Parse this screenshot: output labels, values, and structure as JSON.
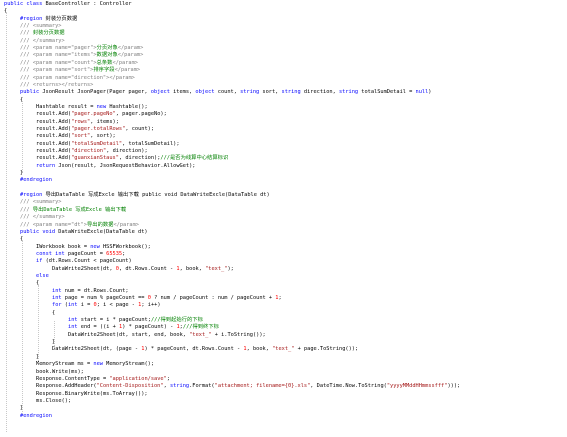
{
  "editor": {
    "lines": [
      {
        "indent": 0,
        "tokens": [
          {
            "k": "kw",
            "t": "public class "
          },
          {
            "k": "tx",
            "t": "BaseController : Controller"
          }
        ]
      },
      {
        "indent": 0,
        "tokens": [
          {
            "k": "tx",
            "t": "{"
          }
        ]
      },
      {
        "indent": 1,
        "tokens": [
          {
            "k": "rg",
            "t": "#region "
          },
          {
            "k": "tx",
            "t": "封装分页数据"
          }
        ]
      },
      {
        "indent": 1,
        "tokens": [
          {
            "k": "dc",
            "t": "/// "
          },
          {
            "k": "dc",
            "t": "<summary>"
          }
        ]
      },
      {
        "indent": 1,
        "tokens": [
          {
            "k": "dc",
            "t": "/// "
          },
          {
            "k": "cm",
            "t": "封装分页数据"
          }
        ]
      },
      {
        "indent": 1,
        "tokens": [
          {
            "k": "dc",
            "t": "/// "
          },
          {
            "k": "dc",
            "t": "</summary>"
          }
        ]
      },
      {
        "indent": 1,
        "tokens": [
          {
            "k": "dc",
            "t": "/// "
          },
          {
            "k": "dc",
            "t": "<param name=\"pager\">"
          },
          {
            "k": "cm",
            "t": "分页对象"
          },
          {
            "k": "dc",
            "t": "</param>"
          }
        ]
      },
      {
        "indent": 1,
        "tokens": [
          {
            "k": "dc",
            "t": "/// "
          },
          {
            "k": "dc",
            "t": "<param name=\"items\">"
          },
          {
            "k": "cm",
            "t": "数据对象"
          },
          {
            "k": "dc",
            "t": "</param>"
          }
        ]
      },
      {
        "indent": 1,
        "tokens": [
          {
            "k": "dc",
            "t": "/// "
          },
          {
            "k": "dc",
            "t": "<param name=\"count\">"
          },
          {
            "k": "cm",
            "t": "总条数"
          },
          {
            "k": "dc",
            "t": "</param>"
          }
        ]
      },
      {
        "indent": 1,
        "tokens": [
          {
            "k": "dc",
            "t": "/// "
          },
          {
            "k": "dc",
            "t": "<param name=\"sort\">"
          },
          {
            "k": "cm",
            "t": "排序字段"
          },
          {
            "k": "dc",
            "t": "</param>"
          }
        ]
      },
      {
        "indent": 1,
        "tokens": [
          {
            "k": "dc",
            "t": "/// "
          },
          {
            "k": "dc",
            "t": "<param name=\"direction\">"
          },
          {
            "k": "dc",
            "t": "</param>"
          }
        ]
      },
      {
        "indent": 1,
        "tokens": [
          {
            "k": "dc",
            "t": "/// "
          },
          {
            "k": "dc",
            "t": "<returns></returns>"
          }
        ]
      },
      {
        "indent": 1,
        "tokens": [
          {
            "k": "kw",
            "t": "public "
          },
          {
            "k": "tx",
            "t": "JsonResult JsonPager(Pager pager, "
          },
          {
            "k": "kw",
            "t": "object "
          },
          {
            "k": "tx",
            "t": "items, "
          },
          {
            "k": "kw",
            "t": "object "
          },
          {
            "k": "tx",
            "t": "count, "
          },
          {
            "k": "kw",
            "t": "string "
          },
          {
            "k": "tx",
            "t": "sort, "
          },
          {
            "k": "kw",
            "t": "string "
          },
          {
            "k": "tx",
            "t": "direction, "
          },
          {
            "k": "kw",
            "t": "string "
          },
          {
            "k": "tx",
            "t": "totalSumDetail = "
          },
          {
            "k": "kw",
            "t": "null"
          },
          {
            "k": "tx",
            "t": ")"
          }
        ]
      },
      {
        "indent": 1,
        "tokens": [
          {
            "k": "tx",
            "t": "{"
          }
        ]
      },
      {
        "indent": 2,
        "tokens": [
          {
            "k": "tx",
            "t": "Hashtable result = "
          },
          {
            "k": "kw",
            "t": "new "
          },
          {
            "k": "tx",
            "t": "Hashtable();"
          }
        ]
      },
      {
        "indent": 2,
        "tokens": [
          {
            "k": "tx",
            "t": "result.Add("
          },
          {
            "k": "st",
            "t": "\"pager.pageNo\""
          },
          {
            "k": "tx",
            "t": ", pager.pageNo);"
          }
        ]
      },
      {
        "indent": 2,
        "tokens": [
          {
            "k": "tx",
            "t": "result.Add("
          },
          {
            "k": "st",
            "t": "\"rows\""
          },
          {
            "k": "tx",
            "t": ", items);"
          }
        ]
      },
      {
        "indent": 2,
        "tokens": [
          {
            "k": "tx",
            "t": "result.Add("
          },
          {
            "k": "st",
            "t": "\"pager.totalRows\""
          },
          {
            "k": "tx",
            "t": ", count);"
          }
        ]
      },
      {
        "indent": 2,
        "tokens": [
          {
            "k": "tx",
            "t": "result.Add("
          },
          {
            "k": "st",
            "t": "\"sort\""
          },
          {
            "k": "tx",
            "t": ", sort);"
          }
        ]
      },
      {
        "indent": 2,
        "tokens": [
          {
            "k": "tx",
            "t": "result.Add("
          },
          {
            "k": "st",
            "t": "\"totalSumDetail\""
          },
          {
            "k": "tx",
            "t": ", totalSumDetail);"
          }
        ]
      },
      {
        "indent": 2,
        "tokens": [
          {
            "k": "tx",
            "t": "result.Add("
          },
          {
            "k": "st",
            "t": "\"direction\""
          },
          {
            "k": "tx",
            "t": ", direction);"
          }
        ]
      },
      {
        "indent": 2,
        "tokens": [
          {
            "k": "tx",
            "t": "result.Add("
          },
          {
            "k": "st",
            "t": "\"guanxianStaus\""
          },
          {
            "k": "tx",
            "t": ", direction);"
          },
          {
            "k": "cm",
            "t": "///是否为线算中心结算标识"
          }
        ]
      },
      {
        "indent": 2,
        "tokens": [
          {
            "k": "kw",
            "t": "return "
          },
          {
            "k": "tx",
            "t": "Json(result, JsonRequestBehavior.AllowGet);"
          }
        ]
      },
      {
        "indent": 1,
        "tokens": [
          {
            "k": "tx",
            "t": "}"
          }
        ]
      },
      {
        "indent": 1,
        "tokens": [
          {
            "k": "rg",
            "t": "#endregion"
          }
        ]
      },
      {
        "indent": 0,
        "tokens": [
          {
            "k": "tx",
            "t": ""
          }
        ]
      },
      {
        "indent": 1,
        "tokens": [
          {
            "k": "rg",
            "t": "#region "
          },
          {
            "k": "tx",
            "t": "导出DataTable 写成Excle 输出下载 public void DataWriteExcle(DataTable dt)"
          }
        ]
      },
      {
        "indent": 1,
        "tokens": [
          {
            "k": "dc",
            "t": "/// "
          },
          {
            "k": "dc",
            "t": "<summary>"
          }
        ]
      },
      {
        "indent": 1,
        "tokens": [
          {
            "k": "dc",
            "t": "/// "
          },
          {
            "k": "cm",
            "t": "导出DataTable 写成Excle 输出下载"
          }
        ]
      },
      {
        "indent": 1,
        "tokens": [
          {
            "k": "dc",
            "t": "/// "
          },
          {
            "k": "dc",
            "t": "</summary>"
          }
        ]
      },
      {
        "indent": 1,
        "tokens": [
          {
            "k": "dc",
            "t": "/// "
          },
          {
            "k": "dc",
            "t": "<param name=\"dt\">"
          },
          {
            "k": "cm",
            "t": "导出的数据"
          },
          {
            "k": "dc",
            "t": "</param>"
          }
        ]
      },
      {
        "indent": 1,
        "tokens": [
          {
            "k": "kw",
            "t": "public void "
          },
          {
            "k": "tx",
            "t": "DataWriteExcle(DataTable dt)"
          }
        ]
      },
      {
        "indent": 1,
        "tokens": [
          {
            "k": "tx",
            "t": "{"
          }
        ]
      },
      {
        "indent": 2,
        "tokens": [
          {
            "k": "tx",
            "t": "IWorkbook book = "
          },
          {
            "k": "kw",
            "t": "new "
          },
          {
            "k": "tx",
            "t": "HSSFWorkbook();"
          }
        ]
      },
      {
        "indent": 2,
        "tokens": [
          {
            "k": "kw",
            "t": "const int "
          },
          {
            "k": "tx",
            "t": "pageCount = "
          },
          {
            "k": "nm",
            "t": "65535"
          },
          {
            "k": "tx",
            "t": ";"
          }
        ]
      },
      {
        "indent": 2,
        "tokens": [
          {
            "k": "kw",
            "t": "if "
          },
          {
            "k": "tx",
            "t": "(dt.Rows.Count < pageCount)"
          }
        ]
      },
      {
        "indent": 3,
        "tokens": [
          {
            "k": "tx",
            "t": "DataWrite2Sheet(dt, "
          },
          {
            "k": "nm",
            "t": "0"
          },
          {
            "k": "tx",
            "t": ", dt.Rows.Count - "
          },
          {
            "k": "nm",
            "t": "1"
          },
          {
            "k": "tx",
            "t": ", book, "
          },
          {
            "k": "st",
            "t": "\"text_\""
          },
          {
            "k": "tx",
            "t": ");"
          }
        ]
      },
      {
        "indent": 2,
        "tokens": [
          {
            "k": "kw",
            "t": "else"
          }
        ]
      },
      {
        "indent": 2,
        "tokens": [
          {
            "k": "tx",
            "t": "{"
          }
        ]
      },
      {
        "indent": 3,
        "tokens": [
          {
            "k": "kw",
            "t": "int "
          },
          {
            "k": "tx",
            "t": "num = dt.Rows.Count;"
          }
        ]
      },
      {
        "indent": 3,
        "tokens": [
          {
            "k": "kw",
            "t": "int "
          },
          {
            "k": "tx",
            "t": "page = num % pageCount == "
          },
          {
            "k": "nm",
            "t": "0"
          },
          {
            "k": "tx",
            "t": " ? num / pageCount : num / pageCount + "
          },
          {
            "k": "nm",
            "t": "1"
          },
          {
            "k": "tx",
            "t": ";"
          }
        ]
      },
      {
        "indent": 3,
        "tokens": [
          {
            "k": "kw",
            "t": "for "
          },
          {
            "k": "tx",
            "t": "("
          },
          {
            "k": "kw",
            "t": "int "
          },
          {
            "k": "tx",
            "t": "i = "
          },
          {
            "k": "nm",
            "t": "0"
          },
          {
            "k": "tx",
            "t": "; i < page - "
          },
          {
            "k": "nm",
            "t": "1"
          },
          {
            "k": "tx",
            "t": "; i++)"
          }
        ]
      },
      {
        "indent": 3,
        "tokens": [
          {
            "k": "tx",
            "t": "{"
          }
        ]
      },
      {
        "indent": 4,
        "tokens": [
          {
            "k": "kw",
            "t": "int "
          },
          {
            "k": "tx",
            "t": "start = i * pageCount;"
          },
          {
            "k": "cm",
            "t": "///得到起始行的下标"
          }
        ]
      },
      {
        "indent": 4,
        "tokens": [
          {
            "k": "kw",
            "t": "int "
          },
          {
            "k": "tx",
            "t": "end = ((i + "
          },
          {
            "k": "nm",
            "t": "1"
          },
          {
            "k": "tx",
            "t": ") * pageCount) - "
          },
          {
            "k": "nm",
            "t": "1"
          },
          {
            "k": "tx",
            "t": ";"
          },
          {
            "k": "cm",
            "t": "///得到终下标"
          }
        ]
      },
      {
        "indent": 4,
        "tokens": [
          {
            "k": "tx",
            "t": "DataWrite2Sheet(dt, start, end, book, "
          },
          {
            "k": "st",
            "t": "\"text_\""
          },
          {
            "k": "tx",
            "t": " + i.ToString());"
          }
        ]
      },
      {
        "indent": 3,
        "tokens": [
          {
            "k": "tx",
            "t": "}"
          }
        ]
      },
      {
        "indent": 3,
        "tokens": [
          {
            "k": "tx",
            "t": "DataWrite2Sheet(dt, (page - "
          },
          {
            "k": "nm",
            "t": "1"
          },
          {
            "k": "tx",
            "t": ") * pageCount, dt.Rows.Count - "
          },
          {
            "k": "nm",
            "t": "1"
          },
          {
            "k": "tx",
            "t": ", book, "
          },
          {
            "k": "st",
            "t": "\"text_\""
          },
          {
            "k": "tx",
            "t": " + page.ToString());"
          }
        ]
      },
      {
        "indent": 2,
        "tokens": [
          {
            "k": "tx",
            "t": "}"
          }
        ]
      },
      {
        "indent": 2,
        "tokens": [
          {
            "k": "tx",
            "t": "MemoryStream ms = "
          },
          {
            "k": "kw",
            "t": "new "
          },
          {
            "k": "tx",
            "t": "MemoryStream();"
          }
        ]
      },
      {
        "indent": 2,
        "tokens": [
          {
            "k": "tx",
            "t": "book.Write(ms);"
          }
        ]
      },
      {
        "indent": 2,
        "tokens": [
          {
            "k": "tx",
            "t": "Response.ContentType = "
          },
          {
            "k": "st",
            "t": "\"application/save\""
          },
          {
            "k": "tx",
            "t": ";"
          }
        ]
      },
      {
        "indent": 2,
        "tokens": [
          {
            "k": "tx",
            "t": "Response.AddHeader("
          },
          {
            "k": "st",
            "t": "\"Content-Disposition\""
          },
          {
            "k": "tx",
            "t": ", "
          },
          {
            "k": "kw",
            "t": "string"
          },
          {
            "k": "tx",
            "t": ".Format("
          },
          {
            "k": "st",
            "t": "\"attachment; filename={0}.xls\""
          },
          {
            "k": "tx",
            "t": ", DateTime.Now.ToString("
          },
          {
            "k": "st",
            "t": "\"yyyyMMddHHmmssfff\""
          },
          {
            "k": "tx",
            "t": ")));"
          }
        ]
      },
      {
        "indent": 2,
        "tokens": [
          {
            "k": "tx",
            "t": "Response.BinaryWrite(ms.ToArray());"
          }
        ]
      },
      {
        "indent": 2,
        "tokens": [
          {
            "k": "tx",
            "t": "ms.Close();"
          }
        ]
      },
      {
        "indent": 1,
        "tokens": [
          {
            "k": "tx",
            "t": "}"
          }
        ]
      },
      {
        "indent": 1,
        "tokens": [
          {
            "k": "rg",
            "t": "#endregion"
          }
        ]
      }
    ]
  }
}
